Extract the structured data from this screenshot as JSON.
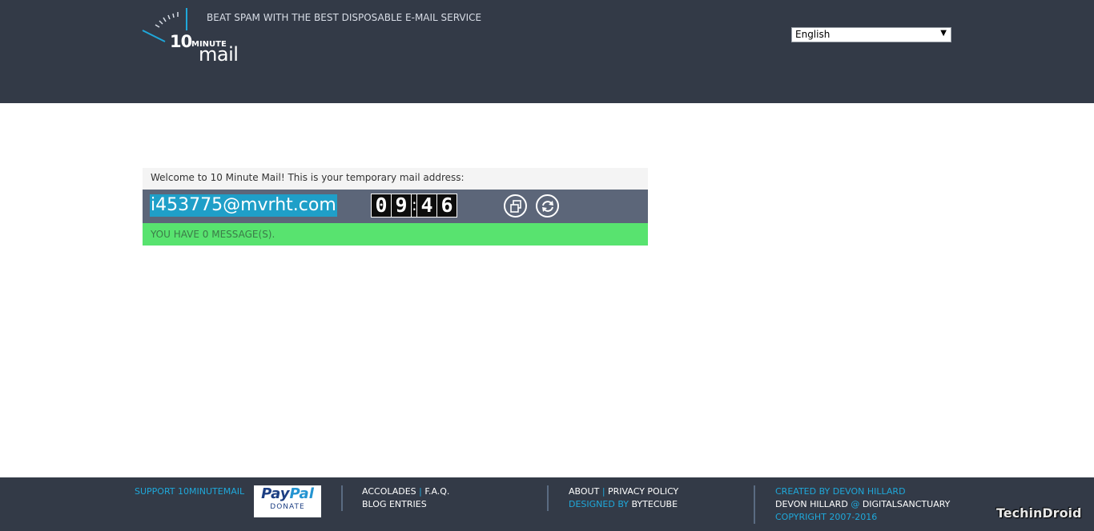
{
  "header": {
    "logo": {
      "number": "10",
      "minute": "MINUTE",
      "mail": "mail"
    },
    "tagline": "BEAT SPAM WITH THE BEST DISPOSABLE E-MAIL SERVICE",
    "language": {
      "selected": "English"
    }
  },
  "main": {
    "welcome": "Welcome to 10 Minute Mail! This is your temporary mail address:",
    "email": "i453775@mvrht.com",
    "timer": {
      "m1": "0",
      "m2": "9",
      "colon": ":",
      "s1": "4",
      "s2": "6"
    },
    "message_status": "YOU HAVE 0 MESSAGE(S)."
  },
  "footer": {
    "support": "SUPPORT 10MINUTEMAIL",
    "paypal": {
      "pay": "Pay",
      "pal": "Pal",
      "donate": "DONATE"
    },
    "col2": {
      "accolades": "ACCOLADES",
      "sep": "|",
      "faq": "F.A.Q.",
      "blog": "BLOG ENTRIES"
    },
    "col3": {
      "about": "ABOUT",
      "sep": "|",
      "privacy": "PRIVACY POLICY",
      "designed_by": "DESIGNED BY",
      "bytecube": "BYTECUBE"
    },
    "col4": {
      "created_by": "CREATED BY DEVON HILLARD",
      "devon": "DEVON HILLARD",
      "at": "@",
      "sanctuary": "DIGITALSANCTUARY",
      "copyright": "COPYRIGHT 2007-2016"
    }
  },
  "watermark": "TechinDroid",
  "colors": {
    "header_bg": "#333a47",
    "accent": "#1fa8da",
    "success": "#58e36f",
    "mailbar": "#5c6679"
  }
}
